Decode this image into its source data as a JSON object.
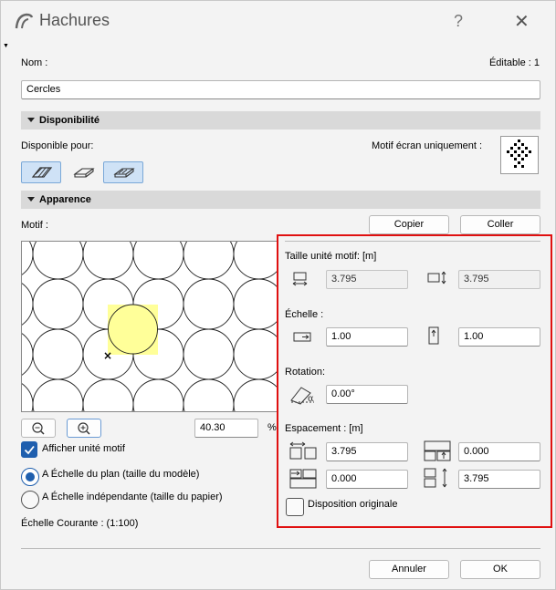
{
  "window": {
    "title": "Hachures",
    "help_label": "?",
    "close_label": "✕"
  },
  "nom": {
    "label": "Nom :",
    "editable_label": "Éditable : 1",
    "value": "Cercles"
  },
  "disponibilite": {
    "header": "Disponibilité",
    "available_for_label": "Disponible pour:",
    "screen_only_label": "Motif écran uniquement :"
  },
  "apparence": {
    "header": "Apparence",
    "motif_label": "Motif :",
    "copy_label": "Copier",
    "paste_label": "Coller",
    "zoom_value": "40.30",
    "zoom_unit": "%",
    "show_unit_label": "Afficher unité motif",
    "scale_plan_label": "A Échelle du plan (taille du modèle)",
    "scale_indep_label": "A Échelle indépendante (taille du papier)",
    "current_scale_label": "Échelle Courante : (1:100)"
  },
  "params": {
    "unit_size_label": "Taille unité motif: [m]",
    "unit_w": "3.795",
    "unit_h": "3.795",
    "scale_label": "Échelle :",
    "scale_x": "1.00",
    "scale_y": "1.00",
    "rotation_label": "Rotation:",
    "rotation_value": "0.00°",
    "spacing_label": "Espacement : [m]",
    "spacing_1": "3.795",
    "spacing_2": "0.000",
    "spacing_3": "0.000",
    "spacing_4": "3.795",
    "original_layout_label": "Disposition originale"
  },
  "footer": {
    "cancel_label": "Annuler",
    "ok_label": "OK"
  },
  "colors": {
    "accent": "#1f5fae",
    "highlight": "#ffff99",
    "red_frame": "#e01010"
  }
}
